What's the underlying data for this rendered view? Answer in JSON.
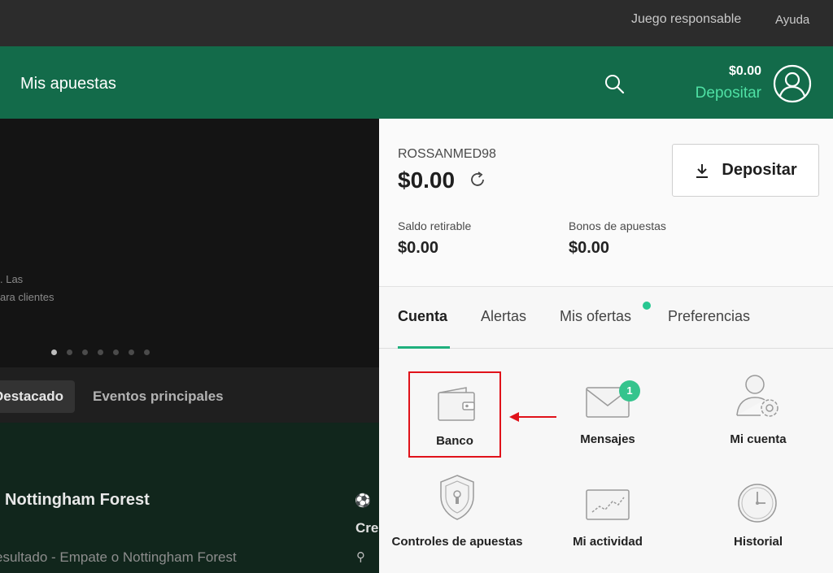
{
  "topbar": {
    "responsible_gaming": "Juego responsable",
    "help": "Ayuda"
  },
  "header": {
    "title": "Mis apuestas",
    "balance": "$0.00",
    "deposit_link": "Depositar"
  },
  "hero": {
    "text1": ". Las",
    "text2": "ara clientes",
    "slides": 7,
    "active_slide": 0
  },
  "sport_tabs": {
    "featured": "Destacado",
    "top_events": "Eventos principales"
  },
  "events": {
    "match": "Nottingham Forest",
    "result": "esultado - Empate o Nottingham Forest",
    "cre": "Cre"
  },
  "account": {
    "username": "ROSSANMED98",
    "total": "$0.00",
    "deposit_button": "Depositar",
    "withdrawable_label": "Saldo retirable",
    "withdrawable_value": "$0.00",
    "bonus_label": "Bonos de apuestas",
    "bonus_value": "$0.00",
    "tabs": [
      "Cuenta",
      "Alertas",
      "Mis ofertas",
      "Preferencias"
    ],
    "active_tab": "Cuenta",
    "tiles": {
      "bank": "Banco",
      "messages": "Mensajes",
      "messages_badge": "1",
      "my_account": "Mi cuenta",
      "bet_controls": "Controles de apuestas",
      "my_activity": "Mi actividad",
      "history": "Historial"
    }
  },
  "colors": {
    "header_green": "#136b4a",
    "accent": "#4fe0a4",
    "highlight_red": "#e0121a"
  },
  "icons": [
    "search-icon",
    "user-avatar-icon",
    "refresh-icon",
    "download-icon",
    "wallet-icon",
    "envelope-icon",
    "user-settings-icon",
    "shield-lock-icon",
    "chart-icon",
    "clock-icon",
    "arrow-left-icon"
  ]
}
